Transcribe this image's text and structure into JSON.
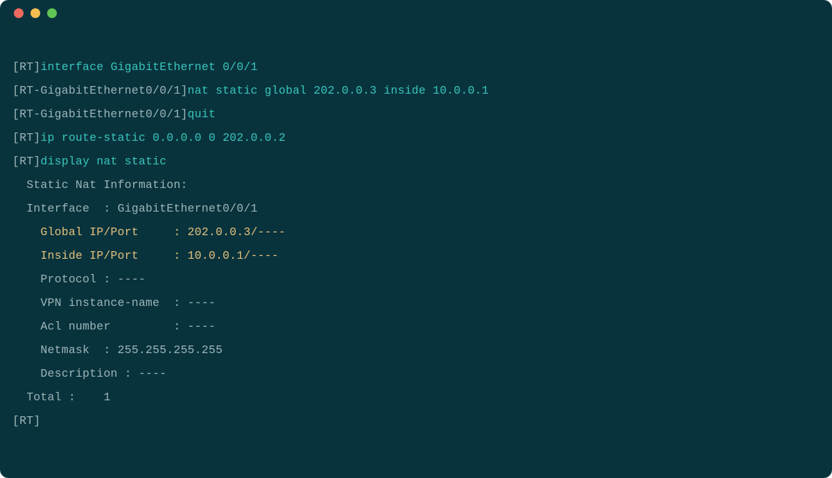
{
  "titlebar": {
    "dots": [
      "red",
      "yellow",
      "green"
    ]
  },
  "lines": [
    {
      "kind": "cmd",
      "prompt": "[RT]",
      "command": "interface GigabitEthernet 0/0/1"
    },
    {
      "kind": "cmd",
      "prompt": "[RT-GigabitEthernet0/0/1]",
      "command": "nat static global 202.0.0.3 inside 10.0.0.1"
    },
    {
      "kind": "cmd",
      "prompt": "[RT-GigabitEthernet0/0/1]",
      "command": "quit"
    },
    {
      "kind": "cmd",
      "prompt": "[RT]",
      "command": "ip route-static 0.0.0.0 0 202.0.0.2"
    },
    {
      "kind": "cmd",
      "prompt": "[RT]",
      "command": "display nat static"
    },
    {
      "kind": "out",
      "text": "  Static Nat Information:"
    },
    {
      "kind": "out",
      "text": "  Interface  : GigabitEthernet0/0/1"
    },
    {
      "kind": "hl",
      "text": "    Global IP/Port     : 202.0.0.3/---- "
    },
    {
      "kind": "hl",
      "text": "    Inside IP/Port     : 10.0.0.1/----"
    },
    {
      "kind": "out",
      "text": "    Protocol : ---- "
    },
    {
      "kind": "out",
      "text": "    VPN instance-name  : ----                            "
    },
    {
      "kind": "out",
      "text": "    Acl number         : ----"
    },
    {
      "kind": "out",
      "text": "    Netmask  : 255.255.255.255 "
    },
    {
      "kind": "out",
      "text": "    Description : ----"
    },
    {
      "kind": "out",
      "text": ""
    },
    {
      "kind": "out",
      "text": "  Total :    1"
    },
    {
      "kind": "cmd",
      "prompt": "[RT]",
      "command": ""
    }
  ]
}
